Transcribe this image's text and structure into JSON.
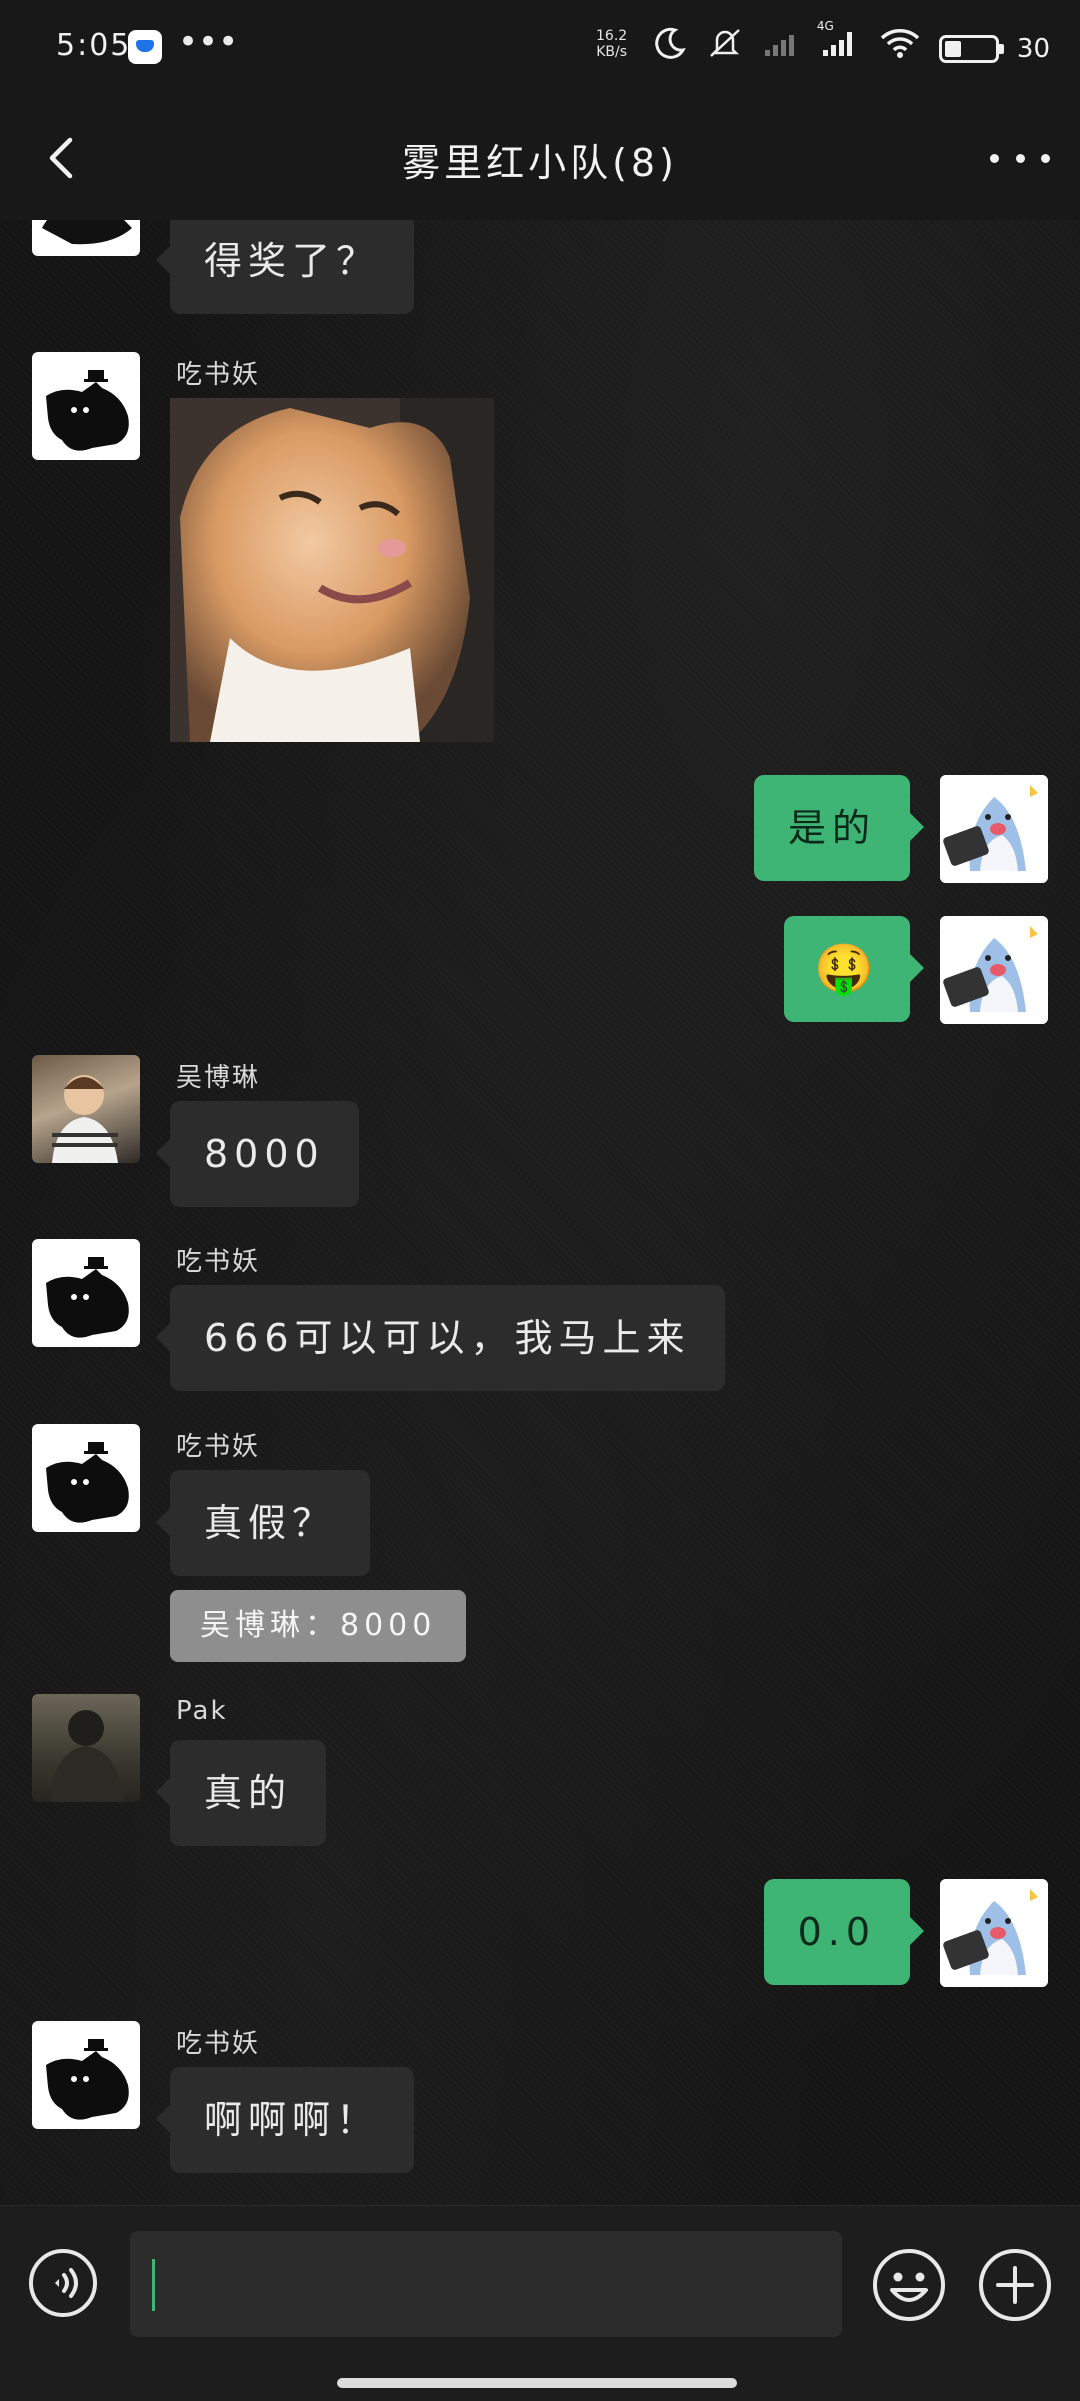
{
  "status_bar": {
    "time": "5:05",
    "dots": "•••",
    "net_speed_value": "16.2",
    "net_speed_unit": "KB/s",
    "network_type": "4G",
    "battery": "30"
  },
  "header": {
    "back_icon": "chevron-left-icon",
    "title": "雾里红小队(8)",
    "more_icon": "more-horizontal-icon"
  },
  "messages": [
    {
      "side": "in",
      "type": "text",
      "text": "得奖了？"
    },
    {
      "side": "in",
      "sender": "吃书妖",
      "type": "image",
      "image": "smiling-cat-photo"
    },
    {
      "side": "out",
      "type": "text",
      "text": "是的"
    },
    {
      "side": "out",
      "type": "emoji",
      "emoji": "🤑"
    },
    {
      "side": "in",
      "sender": "吴博琳",
      "type": "text",
      "text": "8000"
    },
    {
      "side": "in",
      "sender": "吃书妖",
      "type": "text",
      "text": "666可以可以，我马上来"
    },
    {
      "side": "in",
      "sender": "吃书妖",
      "type": "text",
      "text": "真假？",
      "quote": "吴博琳：8000"
    },
    {
      "side": "in",
      "sender": "Pak",
      "type": "text",
      "text": "真的"
    },
    {
      "side": "out",
      "type": "text",
      "text": "0.0"
    },
    {
      "side": "in",
      "sender": "吃书妖",
      "type": "text",
      "text": "啊啊啊！"
    }
  ],
  "input": {
    "voice_icon": "voice-input-icon",
    "value": "",
    "emoji_icon": "smiley-face-icon",
    "plus_icon": "plus-circle-icon"
  }
}
